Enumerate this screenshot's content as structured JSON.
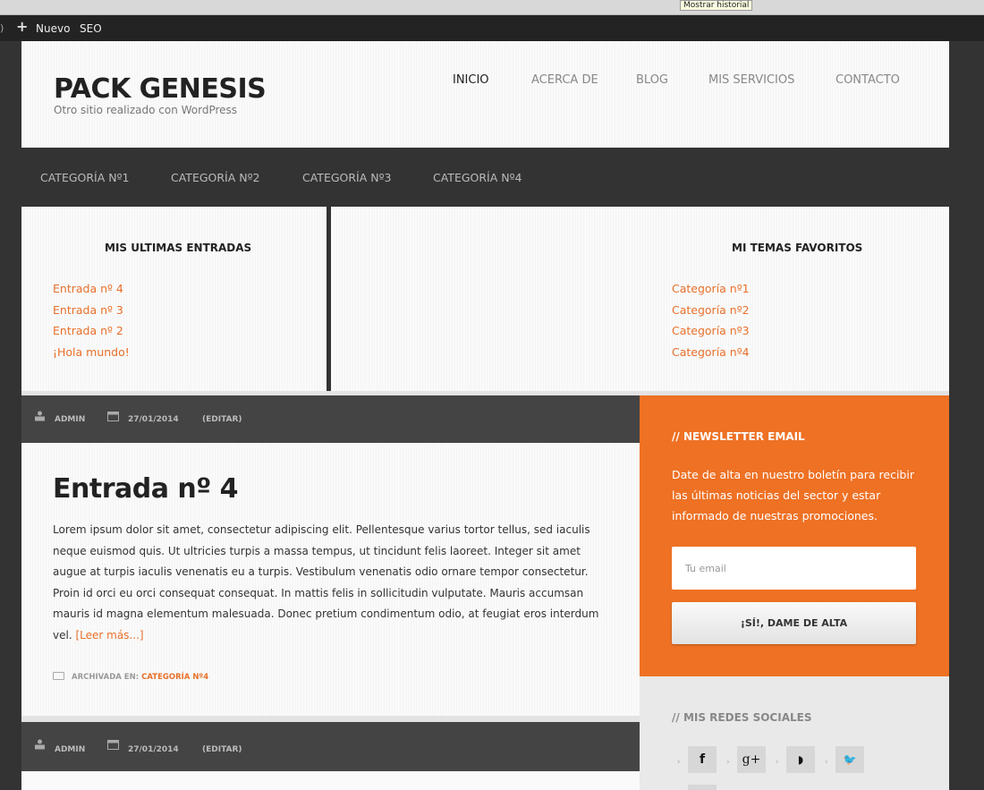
{
  "browser": {
    "tooltip": "Mostrar historial"
  },
  "admin_bar": {
    "edge_glyph": ")",
    "new_label": "Nuevo",
    "seo_label": "SEO"
  },
  "header": {
    "site_title": "PACK GENESIS",
    "site_description": "Otro sitio realizado con WordPress"
  },
  "main_nav": {
    "items": [
      "INICIO",
      "ACERCA DE",
      "BLOG",
      "MIS SERVICIOS",
      "CONTACTO"
    ],
    "active": "INICIO"
  },
  "category_nav": {
    "items": [
      "CATEGORÍA Nº1",
      "CATEGORÍA Nº2",
      "CATEGORÍA Nº3",
      "CATEGORÍA Nº4"
    ]
  },
  "widgets": {
    "latest_posts": {
      "title": "MIS ULTIMAS ENTRADAS",
      "items": [
        "Entrada nº 4",
        "Entrada nº 3",
        "Entrada nº 2",
        "¡Hola mundo!"
      ]
    },
    "favorite_topics": {
      "title": "MI TEMAS FAVORITOS",
      "items": [
        "Categoría nº1",
        "Categoría nº2",
        "Categoría nº3",
        "Categoría nº4"
      ]
    }
  },
  "posts": [
    {
      "author": "ADMIN",
      "date": "27/01/2014",
      "edit": "(EDITAR)",
      "title": "Entrada nº 4",
      "body": "Lorem ipsum dolor sit amet, consectetur adipiscing elit. Pellentesque varius tortor tellus, sed iaculis neque euismod quis. Ut ultricies turpis a massa tempus, ut tincidunt felis laoreet. Integer sit amet augue at turpis iaculis venenatis eu a turpis. Vestibulum venenatis odio ornare tempor consectetur. Proin id orci eu orci consequat consequat. In mattis felis in sollicitudin vulputate. Mauris accumsan mauris id magna elementum malesuada. Donec pretium condimentum odio, at feugiat eros interdum vel.",
      "read_more": "[Leer más...]",
      "filed_label": "ARCHIVADA EN:",
      "category": "CATEGORÍA Nº4"
    },
    {
      "author": "ADMIN",
      "date": "27/01/2014",
      "edit": "(EDITAR)"
    }
  ],
  "newsletter": {
    "title": "// NEWSLETTER EMAIL",
    "text": "Date de alta en nuestro boletín para recibir las últimas noticias del sector y estar informado de nuestras promociones.",
    "email_placeholder": "Tu email",
    "button_label": "¡SÍ!, DAME DE ALTA"
  },
  "social": {
    "title": "// MIS REDES SOCIALES",
    "separator": "›",
    "icons": [
      "facebook-icon",
      "google-plus-icon",
      "rss-icon",
      "twitter-icon"
    ],
    "glyphs": [
      "f",
      "g+",
      "◗",
      "🐦"
    ]
  },
  "colors": {
    "accent": "#ee7124",
    "link": "#e8702a",
    "dark": "#333333",
    "meta_bar": "#444444"
  }
}
